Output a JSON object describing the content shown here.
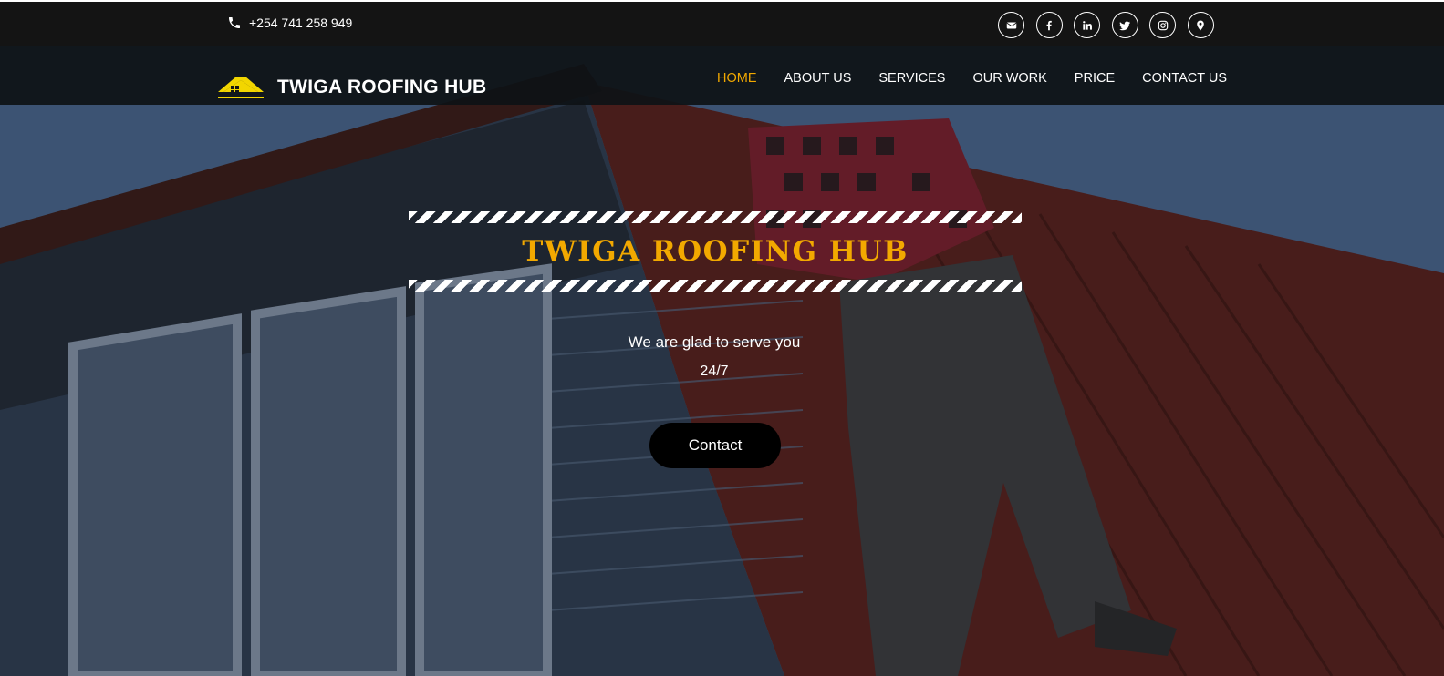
{
  "topbar": {
    "phone": "+254 741 258 949",
    "socials": [
      {
        "icon": "envelope-icon"
      },
      {
        "icon": "facebook-icon"
      },
      {
        "icon": "linkedin-icon"
      },
      {
        "icon": "twitter-icon"
      },
      {
        "icon": "instagram-icon"
      },
      {
        "icon": "map-marker-icon"
      }
    ]
  },
  "brand": {
    "name": "TWIGA ROOFING HUB",
    "accent": "#f2a900"
  },
  "nav": {
    "items": [
      {
        "label": "HOME",
        "active": true
      },
      {
        "label": "ABOUT US"
      },
      {
        "label": "SERVICES"
      },
      {
        "label": "OUR WORK"
      },
      {
        "label": "PRICE"
      },
      {
        "label": "CONTACT US"
      }
    ]
  },
  "hero": {
    "title": "TWIGA ROOFING HUB",
    "tagline": "We are glad to serve you",
    "tagline2": "24/7",
    "cta_label": "Contact"
  }
}
